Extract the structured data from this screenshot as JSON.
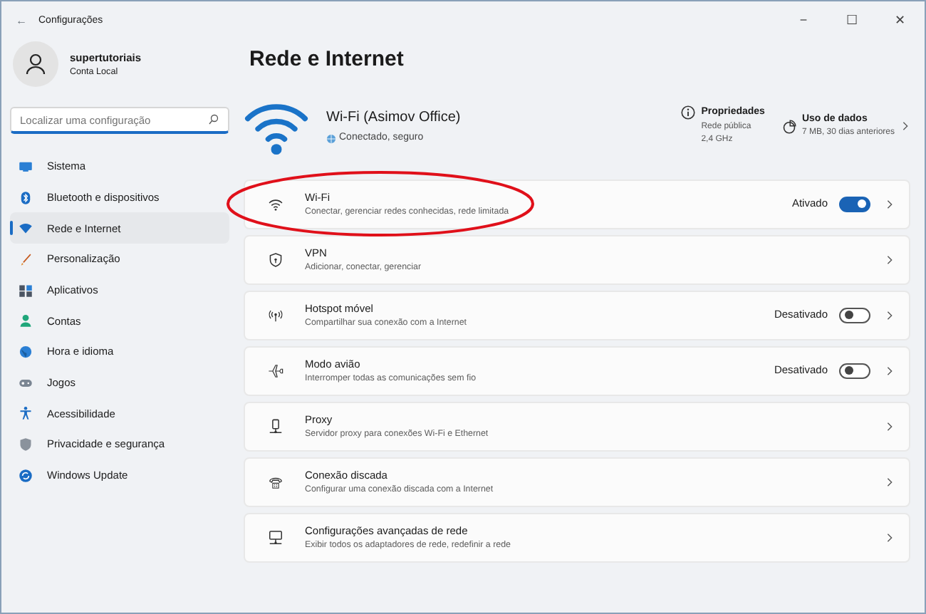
{
  "window": {
    "title": "Configurações",
    "back": "←",
    "controls": [
      "−",
      "☐",
      "✕"
    ]
  },
  "user": {
    "name": "supertutoriais",
    "account": "Conta Local"
  },
  "search": {
    "placeholder": "Localizar uma configuração"
  },
  "sidebar": {
    "items": [
      {
        "label": "Sistema",
        "selected": false
      },
      {
        "label": "Bluetooth e dispositivos",
        "selected": false
      },
      {
        "label": "Rede e Internet",
        "selected": true
      },
      {
        "label": "Personalização",
        "selected": false
      },
      {
        "label": "Aplicativos",
        "selected": false
      },
      {
        "label": "Contas",
        "selected": false
      },
      {
        "label": "Hora e idioma",
        "selected": false
      },
      {
        "label": "Jogos",
        "selected": false
      },
      {
        "label": "Acessibilidade",
        "selected": false
      },
      {
        "label": "Privacidade e segurança",
        "selected": false
      },
      {
        "label": "Windows Update",
        "selected": false
      }
    ]
  },
  "page_title": "Rede e Internet",
  "connection": {
    "name": "Wi-Fi (Asimov Office)",
    "status": "Conectado, seguro"
  },
  "properties": {
    "title": "Propriedades",
    "lines": [
      "Rede pública",
      "2,4 GHz"
    ]
  },
  "data_usage": {
    "title": "Uso de dados",
    "detail": "7 MB, 30 dias anteriores"
  },
  "settings": [
    {
      "title": "Wi-Fi",
      "subtitle": "Conectar, gerenciar redes conhecidas, rede limitada",
      "kind": "toggle",
      "state": "Ativado",
      "on": true,
      "highlighted": true
    },
    {
      "title": "VPN",
      "subtitle": "Adicionar, conectar, gerenciar",
      "kind": "link",
      "highlighted": false
    },
    {
      "title": "Hotspot móvel",
      "subtitle": "Compartilhar sua conexão com a Internet",
      "kind": "toggle",
      "state": "Desativado",
      "on": false,
      "highlighted": false
    },
    {
      "title": "Modo avião",
      "subtitle": "Interromper todas as comunicações sem fio",
      "kind": "toggle",
      "state": "Desativado",
      "on": false,
      "highlighted": false
    },
    {
      "title": "Proxy",
      "subtitle": "Servidor proxy para conexões Wi-Fi e Ethernet",
      "kind": "link",
      "highlighted": false
    },
    {
      "title": "Conexão discada",
      "subtitle": "Configurar uma conexão discada com a Internet",
      "kind": "link",
      "highlighted": false
    },
    {
      "title": "Configurações avançadas de rede",
      "subtitle": "Exibir todos os adaptadores de rede, redefinir a rede",
      "kind": "link",
      "highlighted": false
    }
  ]
}
